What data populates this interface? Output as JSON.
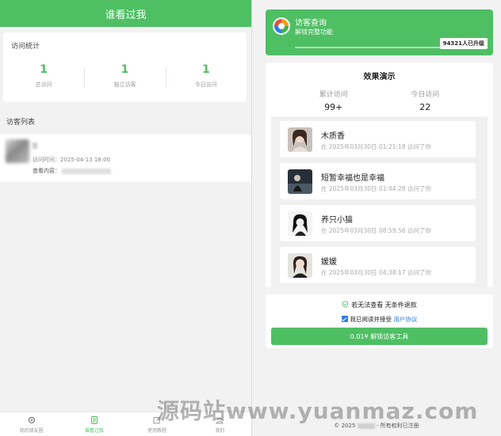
{
  "left": {
    "header_title": "谁看过我",
    "stats_title": "访问统计",
    "stats": [
      {
        "value": "1",
        "label": "总访问"
      },
      {
        "value": "1",
        "label": "独立访客"
      },
      {
        "value": "1",
        "label": "今日访问"
      }
    ],
    "visitor_list_title": "访客列表",
    "visitor": {
      "time_label": "访问时间：2025-04-13 18:00",
      "view_label": "查看内容："
    },
    "nav": [
      {
        "label": "我的朋友圈",
        "icon": "gear-icon"
      },
      {
        "label": "谁看过我",
        "icon": "document-icon"
      },
      {
        "label": "使用教程",
        "icon": "edit-icon"
      },
      {
        "label": "我的",
        "icon": "user-icon"
      }
    ]
  },
  "right": {
    "hero": {
      "title": "访客查询",
      "subtitle": "解锁完整功能",
      "badge": "94321人已升级"
    },
    "demo": {
      "title": "效果演示",
      "stats": [
        {
          "label": "累计访问",
          "value": "99+"
        },
        {
          "label": "今日访问",
          "value": "22"
        }
      ],
      "feed": [
        {
          "name": "木质香",
          "message": "在 2025年03月30日 01:21:18 访问了你",
          "avatar": "portrait-avatar-1"
        },
        {
          "name": "短暂幸福也是幸福",
          "message": "在 2025年03月30日 01:44:28 访问了你",
          "avatar": "portrait-avatar-2"
        },
        {
          "name": "养只小猫",
          "message": "在 2025年03月30日 08:59:56 访问了你",
          "avatar": "portrait-avatar-3"
        },
        {
          "name": "媛媛",
          "message": "在 2025年03月30日 04:38:17 访问了你",
          "avatar": "portrait-avatar-4"
        }
      ]
    },
    "unlock": {
      "guarantee": "若无法查看 无条件退款",
      "agree_text": "我已阅读并接受",
      "agree_link": "用户协议",
      "button": "0.01¥ 解锁访客工具"
    },
    "footer": {
      "prefix": "© 2025",
      "suffix": "- 所有权利已注册"
    }
  },
  "watermark": "源码站www.yuanmaz.com",
  "colors": {
    "accent": "#4fbf64",
    "link": "#2f7be5"
  }
}
